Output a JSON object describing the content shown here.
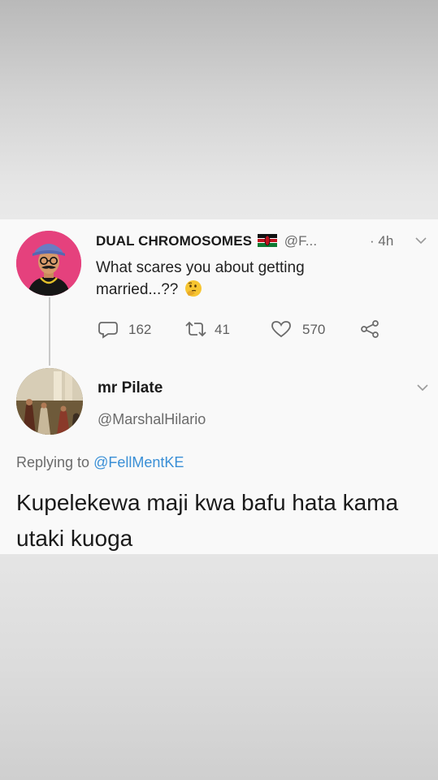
{
  "tweet": {
    "author_name": "DUAL CHROMOSOMES",
    "author_handle": "@F...",
    "time": "· 4h",
    "text": "What scares you about getting married...??",
    "replies": "162",
    "retweets": "41",
    "likes": "570"
  },
  "reply": {
    "author_name": "mr Pilate",
    "author_handle": "@MarshalHilario",
    "replying_label": "Replying to",
    "replying_mention": "@FellMentKE",
    "text": "Kupelekewa maji kwa bafu hata kama utaki kuoga"
  },
  "colors": {
    "mention_blue": "#3a8fd6",
    "avatar1_bg": "#e5417d"
  },
  "icons": [
    "kenya-flag-icon",
    "thinking-face-icon",
    "reply-icon",
    "retweet-icon",
    "like-icon",
    "share-icon",
    "chevron-down-icon"
  ]
}
